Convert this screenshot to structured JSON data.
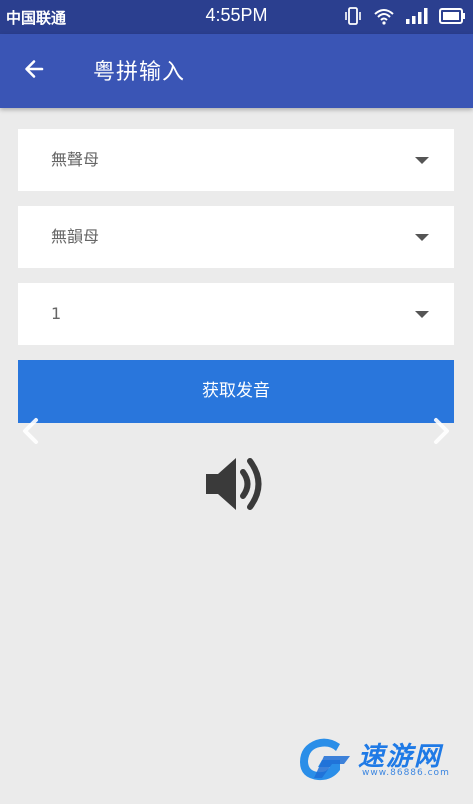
{
  "status_bar": {
    "carrier": "中国联通",
    "time": "4:55PM",
    "icons": [
      "vibrate-icon",
      "wifi-icon",
      "signal-icon",
      "battery-icon"
    ]
  },
  "app_bar": {
    "title": "粤拼输入",
    "back_icon": "back-arrow-icon"
  },
  "selects": {
    "initial": {
      "value": "無聲母"
    },
    "final": {
      "value": "無韻母"
    },
    "tone": {
      "value": "1"
    }
  },
  "action_button": {
    "label": "获取发音"
  },
  "speaker_icon": "speaker-icon",
  "watermark": {
    "title": "速游网",
    "url": "www.86886.com"
  },
  "colors": {
    "status_bar": "#2b3f8f",
    "app_bar": "#3a55b5",
    "button": "#2976dc",
    "background": "#ebebeb"
  }
}
